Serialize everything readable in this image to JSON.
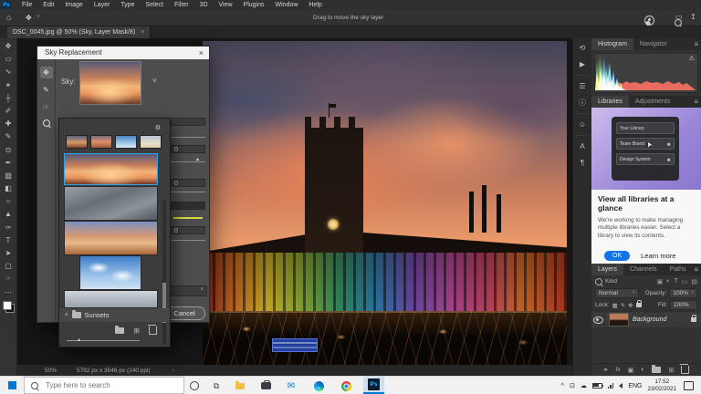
{
  "app": {
    "logo": "Ps",
    "menu": [
      "File",
      "Edit",
      "Image",
      "Layer",
      "Type",
      "Select",
      "Filter",
      "3D",
      "View",
      "Plugins",
      "Window",
      "Help"
    ],
    "options_hint": "Drag to move the sky layer",
    "tab_title": "DSC_0045.jpg @ 50% (Sky, Layer Mask/8)",
    "tab_close": "×"
  },
  "dialog": {
    "title": "Sky Replacement",
    "close": "×",
    "sky_label": "Sky:",
    "group_label": "Sunsets",
    "cancel": "Cancel",
    "values": [
      "0",
      "0",
      "0"
    ]
  },
  "panels": {
    "histogram_tab": "Histogram",
    "navigator_tab": "Navigator",
    "libraries_tab": "Libraries",
    "adjustments_tab": "Adjustments",
    "promo": {
      "rows": [
        "Your Library",
        "Team Brand",
        "Design System"
      ],
      "heading": "View all libraries at a glance",
      "body": "We're working to make managing multiple libraries easier. Select a library to view its contents.",
      "ok": "OK",
      "learn_more": "Learn more"
    },
    "layers_tab": "Layers",
    "channels_tab": "Channels",
    "paths_tab": "Paths",
    "kind": "Kind",
    "blend_mode": "Normal",
    "opacity_label": "Opacity:",
    "opacity_value": "100%",
    "lock_label": "Lock:",
    "fill_label": "Fill:",
    "fill_value": "100%",
    "layer_name": "Background"
  },
  "status": {
    "zoom": "50%",
    "doc_info": "5782 px x 3546 px (240 ppi)",
    "chevron": "›"
  },
  "taskbar": {
    "search_placeholder": "Type here to search",
    "lang": "ENG",
    "time": "17:52",
    "date": "23/02/2021"
  },
  "icons": {
    "home": "⌂",
    "move": "✥",
    "chevron_down": "˅",
    "workspace": "▭",
    "share": "↥",
    "gear": "⚙",
    "warning": "⚠",
    "panel_menu": "≡",
    "marker": "▴",
    "plus": "⊞",
    "cursor": "➤",
    "taskview": "⧉",
    "caret_up": "^",
    "tray1": "⊡",
    "cloud": "☁",
    "person_small": "☻",
    "tools": [
      "✥",
      "▭",
      "∿",
      "✶",
      "┼",
      "✐",
      "✚",
      "✎",
      "⊙",
      "✒",
      "▨",
      "◧",
      "○",
      "▲",
      "✑",
      "T",
      "➤",
      "▢",
      "☞",
      "⋯"
    ],
    "dock": [
      "⟲",
      "▶",
      "☰",
      "ⓘ",
      "☺",
      "A",
      "¶"
    ],
    "filters": [
      "▣",
      "◐",
      "T",
      "▭",
      "▤"
    ],
    "locks": [
      "▦",
      "✎",
      "✥"
    ],
    "bottom": [
      "⚭",
      "fx",
      "▣",
      "◐",
      "⊞"
    ]
  }
}
